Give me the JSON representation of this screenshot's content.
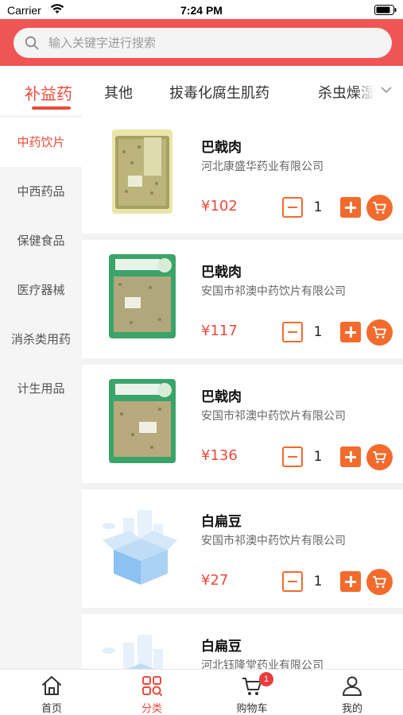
{
  "status_bar": {
    "carrier": "Carrier",
    "time": "7:24 PM"
  },
  "search": {
    "placeholder": "输入关键字进行搜索",
    "value": ""
  },
  "tabs": [
    {
      "label": "补益药",
      "active": true
    },
    {
      "label": "其他"
    },
    {
      "label": "拔毒化腐生肌药"
    },
    {
      "label": "杀虫燥湿"
    }
  ],
  "sidebar": {
    "items": [
      {
        "label": "中药饮片",
        "active": true
      },
      {
        "label": "中西药品"
      },
      {
        "label": "保健食品"
      },
      {
        "label": "医疗器械"
      },
      {
        "label": "消杀类用药"
      },
      {
        "label": "计生用品"
      }
    ]
  },
  "products": [
    {
      "name": "巴戟肉",
      "maker": "河北康盛华药业有限公司",
      "price": "¥102",
      "qty": "1",
      "image": "herb-package-yellow"
    },
    {
      "name": "巴戟肉",
      "maker": "安国市祁澳中药饮片有限公司",
      "price": "¥117",
      "qty": "1",
      "image": "herb-package-green"
    },
    {
      "name": "巴戟肉",
      "maker": "安国市祁澳中药饮片有限公司",
      "price": "¥136",
      "qty": "1",
      "image": "herb-package-green"
    },
    {
      "name": "白扁豆",
      "maker": "安国市祁澳中药饮片有限公司",
      "price": "¥27",
      "qty": "1",
      "image": "empty-box-placeholder"
    },
    {
      "name": "白扁豆",
      "maker": "河北钰隆堂药业有限公司",
      "price": "",
      "qty": "",
      "image": "empty-box-placeholder"
    }
  ],
  "bottom_nav": [
    {
      "label": "首页",
      "icon": "home-icon"
    },
    {
      "label": "分类",
      "icon": "category-icon",
      "active": true
    },
    {
      "label": "购物车",
      "icon": "cart-icon",
      "badge": "1"
    },
    {
      "label": "我的",
      "icon": "user-icon"
    }
  ],
  "colors": {
    "header": "#f05556",
    "accent": "#ea4b3b",
    "button": "#f26b2d"
  }
}
